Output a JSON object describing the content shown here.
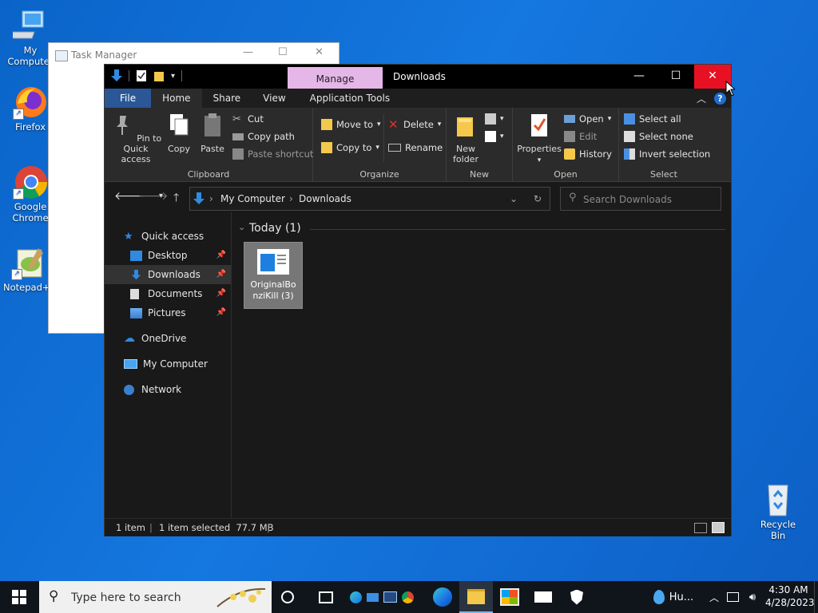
{
  "desktop": {
    "icons": [
      {
        "label": "My Computer"
      },
      {
        "label": "Firefox"
      },
      {
        "label": "Google Chrome"
      },
      {
        "label": "Notepad++"
      },
      {
        "label": "Recycle Bin"
      }
    ]
  },
  "taskmanager": {
    "title": "Task Manager"
  },
  "explorer": {
    "title": "Downloads",
    "context_tab": "Manage",
    "ribbon_tabs": [
      "File",
      "Home",
      "Share",
      "View",
      "Application Tools"
    ],
    "active_tab": "Home",
    "clipboard": {
      "pin": "Pin to Quick access",
      "copy": "Copy",
      "paste": "Paste",
      "cut": "Cut",
      "copy_path": "Copy path",
      "paste_shortcut": "Paste shortcut",
      "label": "Clipboard"
    },
    "organize": {
      "move_to": "Move to",
      "copy_to": "Copy to",
      "delete": "Delete",
      "rename": "Rename",
      "label": "Organize"
    },
    "new_group": {
      "new_folder": "New folder",
      "label": "New"
    },
    "open_group": {
      "properties": "Properties",
      "open": "Open",
      "edit": "Edit",
      "history": "History",
      "label": "Open"
    },
    "select_group": {
      "select_all": "Select all",
      "select_none": "Select none",
      "invert": "Invert selection",
      "label": "Select"
    },
    "address": {
      "crumbs": [
        "My Computer",
        "Downloads"
      ]
    },
    "search": {
      "placeholder": "Search Downloads"
    },
    "nav": {
      "quick_access": "Quick access",
      "desktop": "Desktop",
      "downloads": "Downloads",
      "documents": "Documents",
      "pictures": "Pictures",
      "onedrive": "OneDrive",
      "my_computer": "My Computer",
      "network": "Network"
    },
    "content": {
      "group_header": "Today (1)",
      "file_name_line1": "OriginalBo",
      "file_name_line2": "nziKill (3)"
    },
    "status": {
      "items": "1 item",
      "selected": "1 item selected  77.7 MB"
    }
  },
  "taskbar": {
    "search_placeholder": "Type here to search",
    "weather": "Hu...",
    "time": "4:30 AM",
    "date": "4/28/2023"
  },
  "colors": {
    "accent": "#2b5797",
    "close": "#e81123",
    "manage_tab": "#e5b6e8",
    "desktop": "#1170d8"
  }
}
